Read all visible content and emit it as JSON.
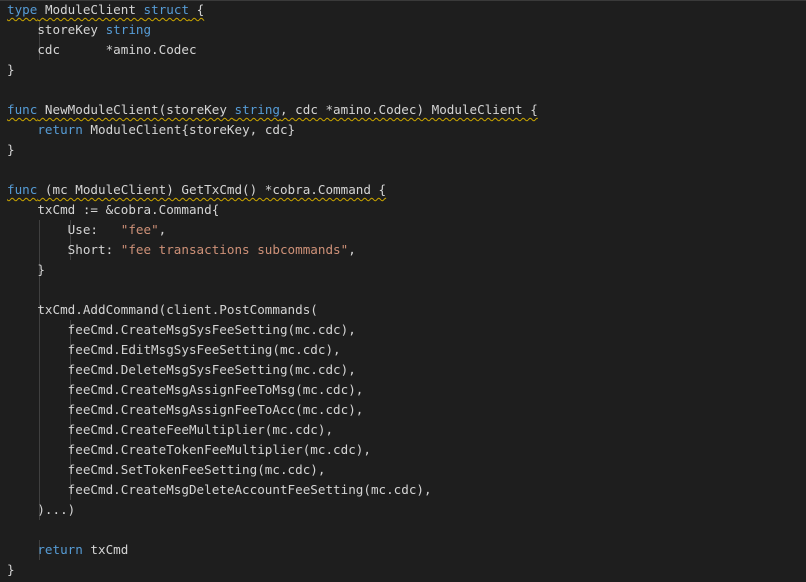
{
  "editor": {
    "background": "#1e1e1e",
    "lines": [
      [
        {
          "t": "type",
          "c": "kw",
          "sq": true
        },
        {
          "t": " ",
          "c": "plain",
          "sq": true
        },
        {
          "t": "ModuleClient",
          "c": "plain",
          "sq": true
        },
        {
          "t": " ",
          "c": "plain",
          "sq": true
        },
        {
          "t": "struct",
          "c": "kw",
          "sq": true
        },
        {
          "t": " {",
          "c": "plain",
          "sq": true
        }
      ],
      [
        {
          "t": "    storeKey ",
          "c": "plain"
        },
        {
          "t": "string",
          "c": "kw"
        }
      ],
      [
        {
          "t": "    cdc      *amino.Codec",
          "c": "plain"
        }
      ],
      [
        {
          "t": "}",
          "c": "plain"
        }
      ],
      [
        {
          "t": "",
          "c": "plain"
        }
      ],
      [
        {
          "t": "func",
          "c": "kw",
          "sq": true
        },
        {
          "t": " NewModuleClient(storeKey ",
          "c": "plain",
          "sq": true
        },
        {
          "t": "string",
          "c": "kw",
          "sq": true
        },
        {
          "t": ", cdc *amino.Codec) ModuleClient {",
          "c": "plain",
          "sq": true
        }
      ],
      [
        {
          "t": "    ",
          "c": "plain"
        },
        {
          "t": "return",
          "c": "kw"
        },
        {
          "t": " ModuleClient{storeKey, cdc}",
          "c": "plain"
        }
      ],
      [
        {
          "t": "}",
          "c": "plain"
        }
      ],
      [
        {
          "t": "",
          "c": "plain"
        }
      ],
      [
        {
          "t": "func",
          "c": "kw",
          "sq": true
        },
        {
          "t": " (mc ModuleClient) GetTxCmd() *cobra.Command {",
          "c": "plain",
          "sq": true
        }
      ],
      [
        {
          "t": "    txCmd := &cobra.Command{",
          "c": "plain"
        }
      ],
      [
        {
          "t": "        Use:   ",
          "c": "plain"
        },
        {
          "t": "\"fee\"",
          "c": "str"
        },
        {
          "t": ",",
          "c": "plain"
        }
      ],
      [
        {
          "t": "        Short: ",
          "c": "plain"
        },
        {
          "t": "\"fee transactions subcommands\"",
          "c": "str"
        },
        {
          "t": ",",
          "c": "plain"
        }
      ],
      [
        {
          "t": "    }",
          "c": "plain"
        }
      ],
      [
        {
          "t": "",
          "c": "plain"
        }
      ],
      [
        {
          "t": "    txCmd.AddCommand(client.PostCommands(",
          "c": "plain"
        }
      ],
      [
        {
          "t": "        feeCmd.CreateMsgSysFeeSetting(mc.cdc),",
          "c": "plain"
        }
      ],
      [
        {
          "t": "        feeCmd.EditMsgSysFeeSetting(mc.cdc),",
          "c": "plain"
        }
      ],
      [
        {
          "t": "        feeCmd.DeleteMsgSysFeeSetting(mc.cdc),",
          "c": "plain"
        }
      ],
      [
        {
          "t": "        feeCmd.CreateMsgAssignFeeToMsg(mc.cdc),",
          "c": "plain"
        }
      ],
      [
        {
          "t": "        feeCmd.CreateMsgAssignFeeToAcc(mc.cdc),",
          "c": "plain"
        }
      ],
      [
        {
          "t": "        feeCmd.CreateFeeMultiplier(mc.cdc),",
          "c": "plain"
        }
      ],
      [
        {
          "t": "        feeCmd.CreateTokenFeeMultiplier(mc.cdc),",
          "c": "plain"
        }
      ],
      [
        {
          "t": "        feeCmd.SetTokenFeeSetting(mc.cdc),",
          "c": "plain"
        }
      ],
      [
        {
          "t": "        feeCmd.CreateMsgDeleteAccountFeeSetting(mc.cdc),",
          "c": "plain"
        }
      ],
      [
        {
          "t": "    )...)",
          "c": "plain"
        }
      ],
      [
        {
          "t": "",
          "c": "plain"
        }
      ],
      [
        {
          "t": "    ",
          "c": "plain"
        },
        {
          "t": "return",
          "c": "kw"
        },
        {
          "t": " txCmd",
          "c": "plain"
        }
      ],
      [
        {
          "t": "}",
          "c": "plain"
        }
      ]
    ]
  }
}
